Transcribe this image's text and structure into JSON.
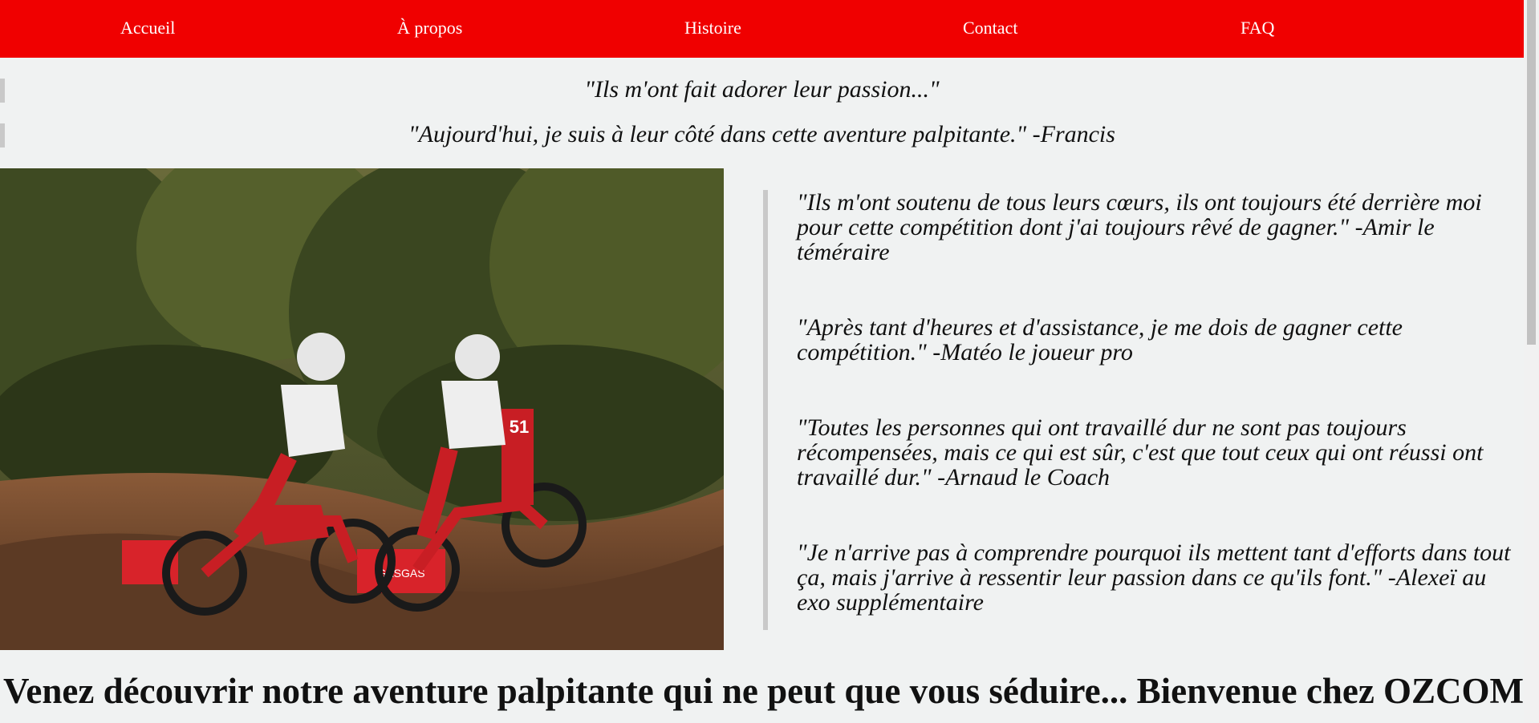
{
  "nav": {
    "items": [
      {
        "label": "Accueil"
      },
      {
        "label": "À propos"
      },
      {
        "label": "Histoire"
      },
      {
        "label": "Contact"
      },
      {
        "label": "FAQ"
      }
    ]
  },
  "top_quotes": [
    "\"Ils m'ont fait adorer leur passion...\"",
    "\"Aujourd'hui, je suis à leur côté dans cette aventure palpitante.\" -Francis"
  ],
  "testimonials": [
    "\"Ils m'ont soutenu de tous leurs cœurs, ils ont toujours été derrière moi pour cette compétition dont j'ai toujours rêvé de gagner.\" -Amir le téméraire",
    "\"Après tant d'heures et d'assistance, je me dois de gagner cette compétition.\" -Matéo le joueur pro",
    "\"Toutes les personnes qui ont travaillé dur ne sont pas toujours récompensées, mais ce qui est sûr, c'est que tout ceux qui ont réussi ont travaillé dur.\" -Arnaud le Coach",
    "\"Je n'arrive pas à comprendre pourquoi ils mettent tant d'efforts dans tout ça, mais j'arrive à ressentir leur passion dans ce qu'ils font.\" -Alexeï au exo supplémentaire"
  ],
  "photo": {
    "banner_text": "GASGAS",
    "bike_number": "51"
  },
  "headline": "Venez découvrir notre aventure palpitante qui ne peut que vous séduire... Bienvenue chez OZCOM",
  "colors": {
    "nav_background": "#f00000",
    "page_background": "#f0f2f2",
    "quote_bar": "#c9c9c9"
  }
}
